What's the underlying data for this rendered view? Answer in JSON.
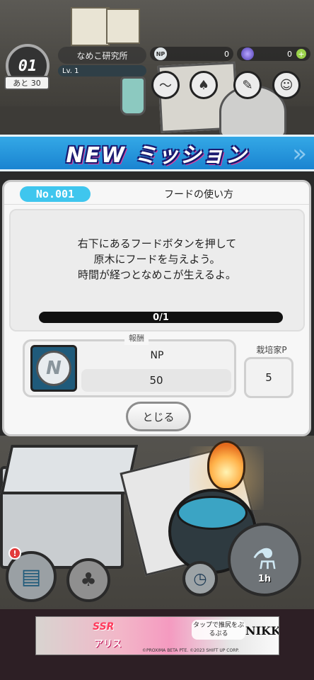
{
  "hud": {
    "day_number": "01",
    "remaining": "あと 30",
    "lab_name": "なめこ研究所",
    "level_label": "Lv. 1",
    "level_progress": 0.0,
    "np_icon": "NP",
    "np_value": "0",
    "gem_value": "0"
  },
  "banner": {
    "title": "NEW ミッション"
  },
  "mission": {
    "number": "No.001",
    "title": "フードの使い方",
    "description": [
      "右下にあるフードボタンを押して",
      "原木にフードを与えよう。",
      "時間が経つとなめこが生えるよ。"
    ],
    "progress_text": "0/1",
    "progress_fraction": 0.0,
    "reward_label": "報酬",
    "reward_icon_letter": "N",
    "reward_name": "NP",
    "reward_amount": "50",
    "grower_label": "栽培家P",
    "grower_points": "5",
    "close_label": "とじる"
  },
  "bottom": {
    "alert_count": "!",
    "food_timer": "1h"
  },
  "ad": {
    "ssr": "SSR",
    "character": "アリス",
    "tagline": "タップで推尻をぷるぷる",
    "logo": "NIKKE",
    "credit": "©PROXIMA BETA PTE. ©2023 SHIFT UP CORP."
  },
  "colors": {
    "banner_blue": "#1a84d1",
    "mission_no_cyan": "#3fc6ee",
    "progress_track": "#111111"
  }
}
